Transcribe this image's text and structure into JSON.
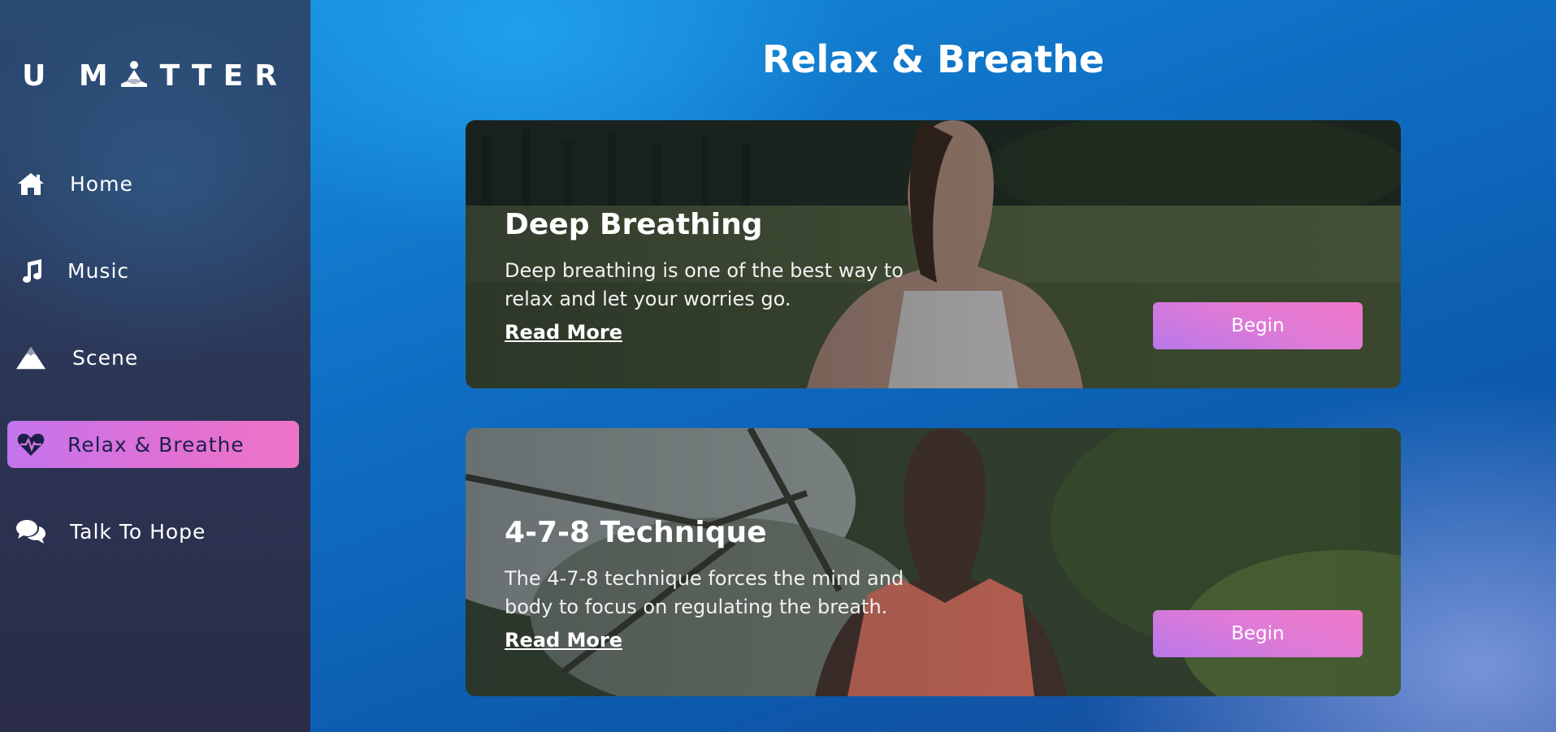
{
  "brand": {
    "logo_left": "U M",
    "logo_right": "TTER",
    "logo_icon": "meditation-icon"
  },
  "nav": [
    {
      "label": "Home",
      "icon": "home-icon",
      "active": false
    },
    {
      "label": "Music",
      "icon": "music-icon",
      "active": false
    },
    {
      "label": "Scene",
      "icon": "mountain-icon",
      "active": false
    },
    {
      "label": "Relax & Breathe",
      "icon": "heartbeat-icon",
      "active": true
    },
    {
      "label": "Talk To Hope",
      "icon": "chat-icon",
      "active": false
    }
  ],
  "page": {
    "title": "Relax & Breathe"
  },
  "cards": [
    {
      "title": "Deep Breathing",
      "description": "Deep breathing is one of the best way to relax and let your worries go.",
      "read_more": "Read More",
      "button": "Begin"
    },
    {
      "title": "4-7-8 Technique",
      "description": "The 4-7-8 technique forces the mind and body to focus on regulating the breath.",
      "read_more": "Read More",
      "button": "Begin"
    }
  ],
  "colors": {
    "accent_gradient_start": "#c474ee",
    "accent_gradient_end": "#ee74c6",
    "sidebar_bg": "#2c3555",
    "page_bg": "#0f6fc4"
  }
}
